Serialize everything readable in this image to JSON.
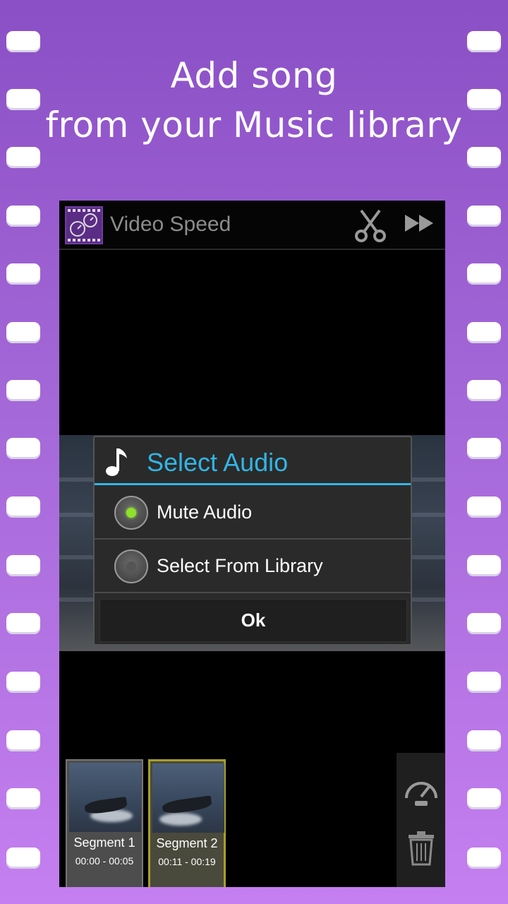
{
  "headline": {
    "line1": "Add song",
    "line2": "from your Music library"
  },
  "app": {
    "title": "Video Speed",
    "logo_icon": "video-speed-logo-icon",
    "actions": [
      {
        "name": "scissors-icon",
        "label": "Trim"
      },
      {
        "name": "fast-forward-icon",
        "label": "Next"
      }
    ]
  },
  "dialog": {
    "title": "Select Audio",
    "title_icon": "music-note-icon",
    "accent": "#33b5e5",
    "options": [
      {
        "label": "Mute Audio",
        "selected": true
      },
      {
        "label": "Select From Library",
        "selected": false
      }
    ],
    "ok_label": "Ok"
  },
  "segments": [
    {
      "name": "Segment 1",
      "time": "00:00 - 00:05",
      "active": false
    },
    {
      "name": "Segment 2",
      "time": "00:11 - 00:19",
      "active": true
    }
  ],
  "tools": [
    {
      "name": "speedometer-icon"
    },
    {
      "name": "trash-icon"
    }
  ],
  "colors": {
    "background_top": "#8b4fc6",
    "background_bottom": "#c57ff0",
    "radio_selected": "#8ee22b",
    "segment_active_border": "#a89f2a"
  }
}
